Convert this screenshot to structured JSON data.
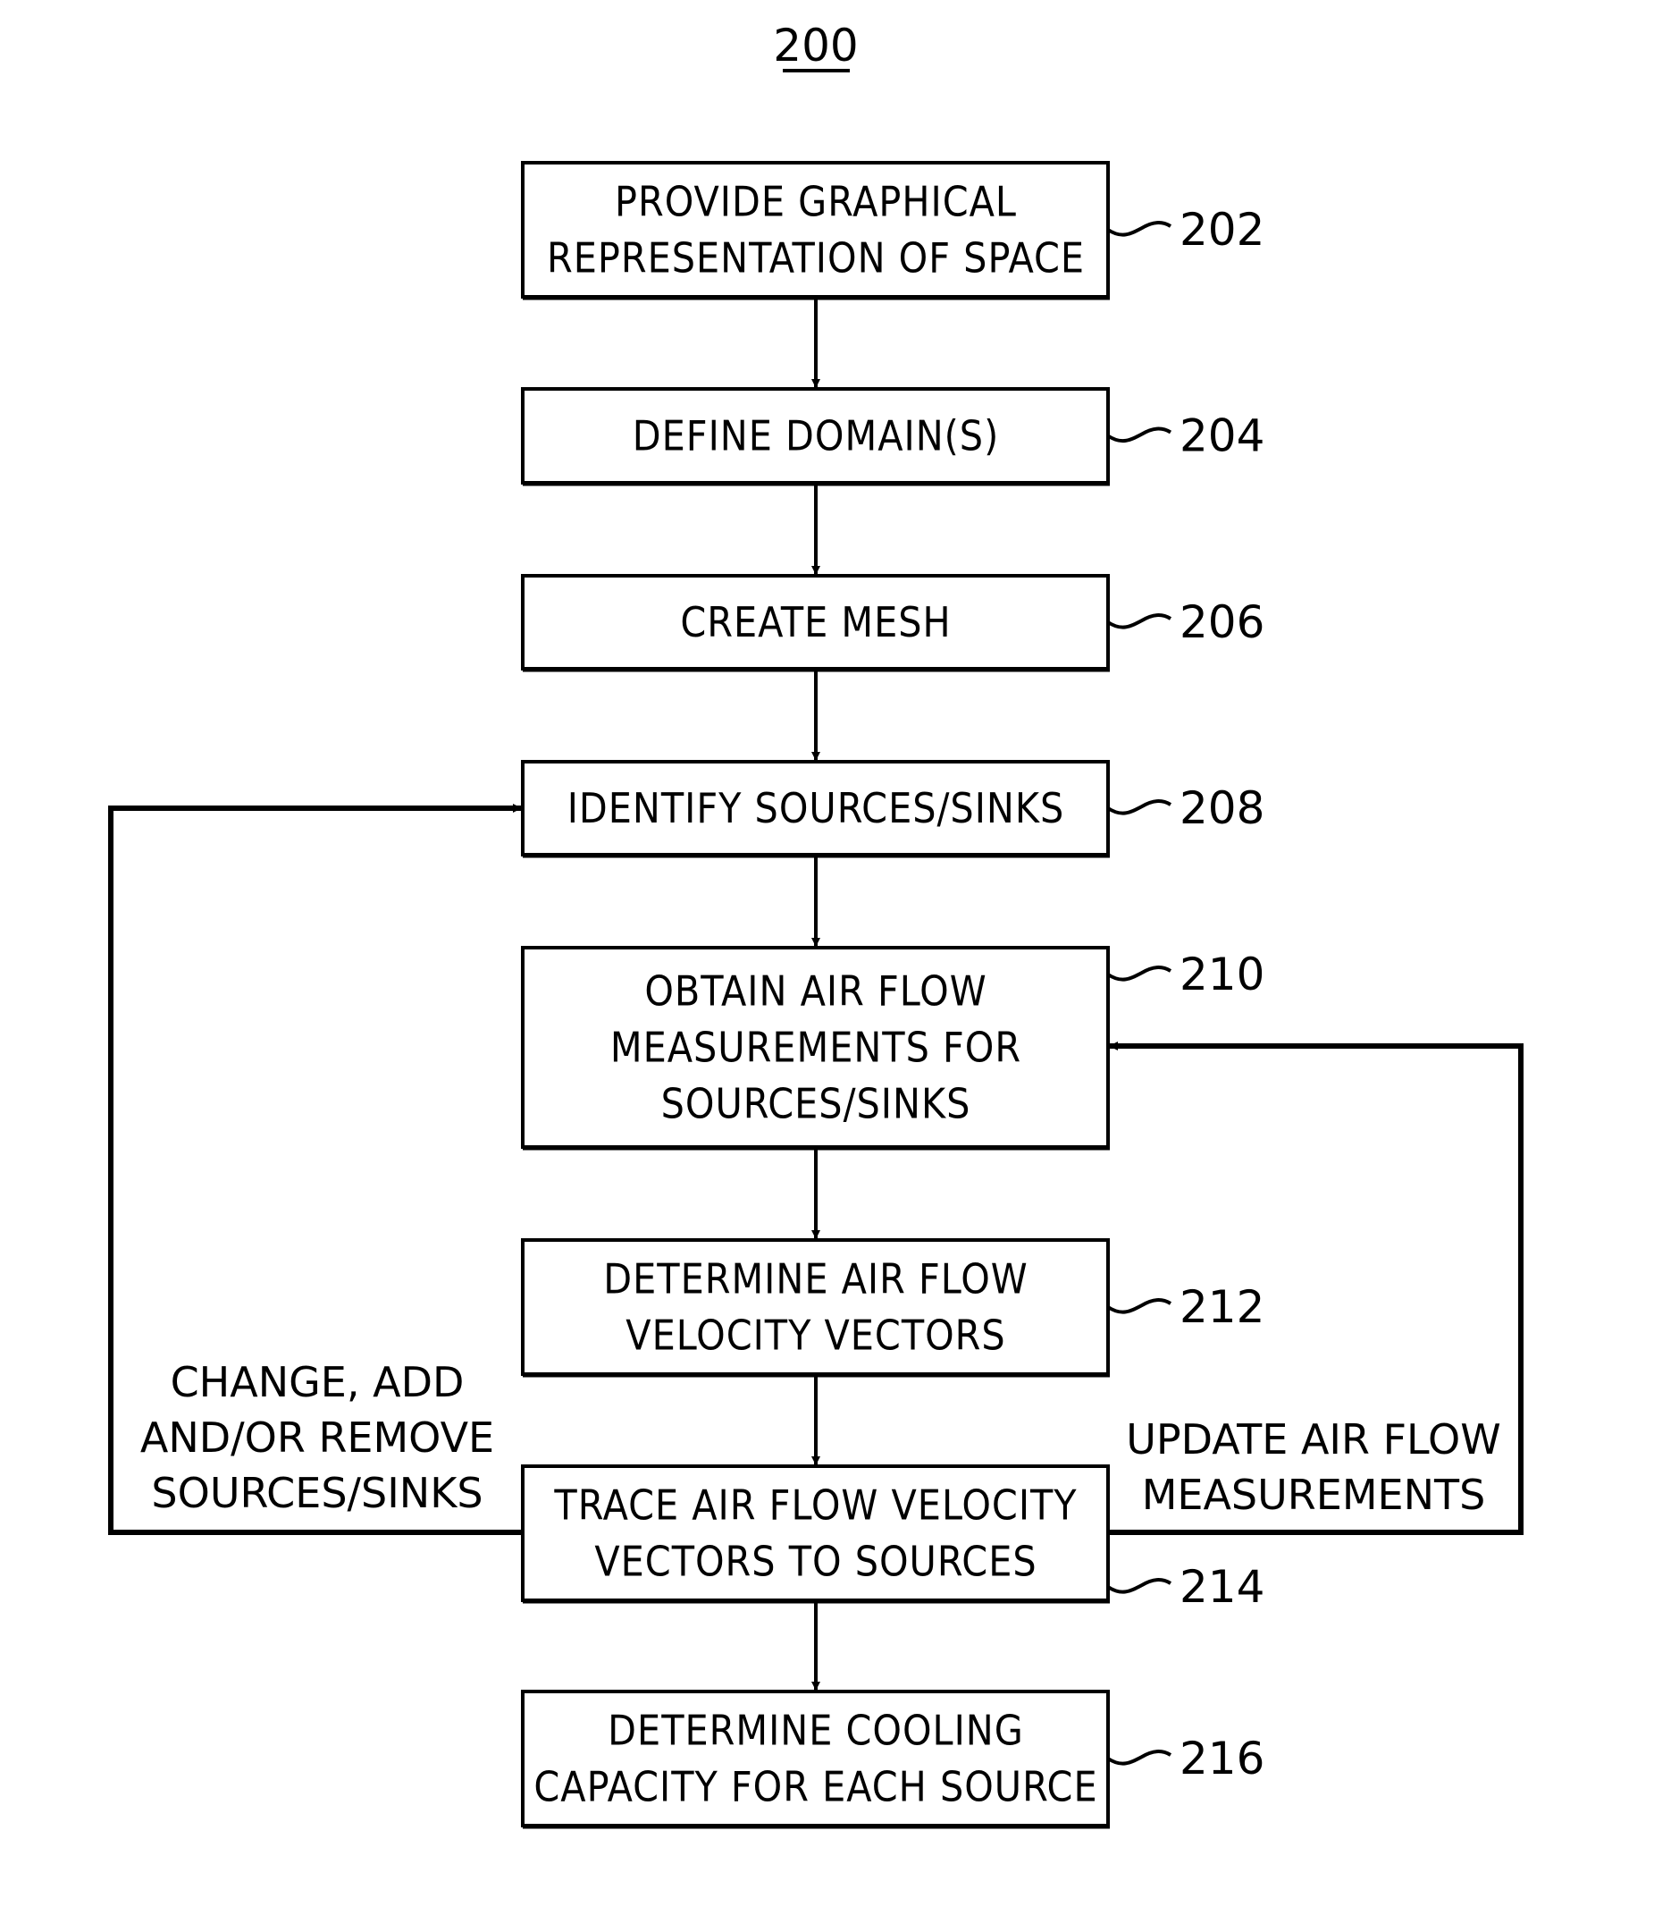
{
  "figure": {
    "number": "200",
    "colors": {
      "ink": "#000000",
      "background": "#ffffff"
    }
  },
  "steps": [
    {
      "ref": "202",
      "lines": [
        "PROVIDE GRAPHICAL",
        "REPRESENTATION OF SPACE"
      ]
    },
    {
      "ref": "204",
      "lines": [
        "DEFINE DOMAIN(S)"
      ]
    },
    {
      "ref": "206",
      "lines": [
        "CREATE MESH"
      ]
    },
    {
      "ref": "208",
      "lines": [
        "IDENTIFY SOURCES/SINKS"
      ]
    },
    {
      "ref": "210",
      "lines": [
        "OBTAIN AIR FLOW",
        "MEASUREMENTS FOR",
        "SOURCES/SINKS"
      ]
    },
    {
      "ref": "212",
      "lines": [
        "DETERMINE AIR FLOW",
        "VELOCITY VECTORS"
      ]
    },
    {
      "ref": "214",
      "lines": [
        "TRACE AIR FLOW VELOCITY",
        "VECTORS TO SOURCES"
      ]
    },
    {
      "ref": "216",
      "lines": [
        "DETERMINE COOLING",
        "CAPACITY FOR EACH SOURCE"
      ]
    }
  ],
  "loops": {
    "left": {
      "from": "214",
      "to": "208",
      "lines": [
        "CHANGE, ADD",
        "AND/OR REMOVE",
        "SOURCES/SINKS"
      ]
    },
    "right": {
      "from": "214",
      "to": "210",
      "lines": [
        "UPDATE AIR FLOW",
        "MEASUREMENTS"
      ]
    }
  }
}
